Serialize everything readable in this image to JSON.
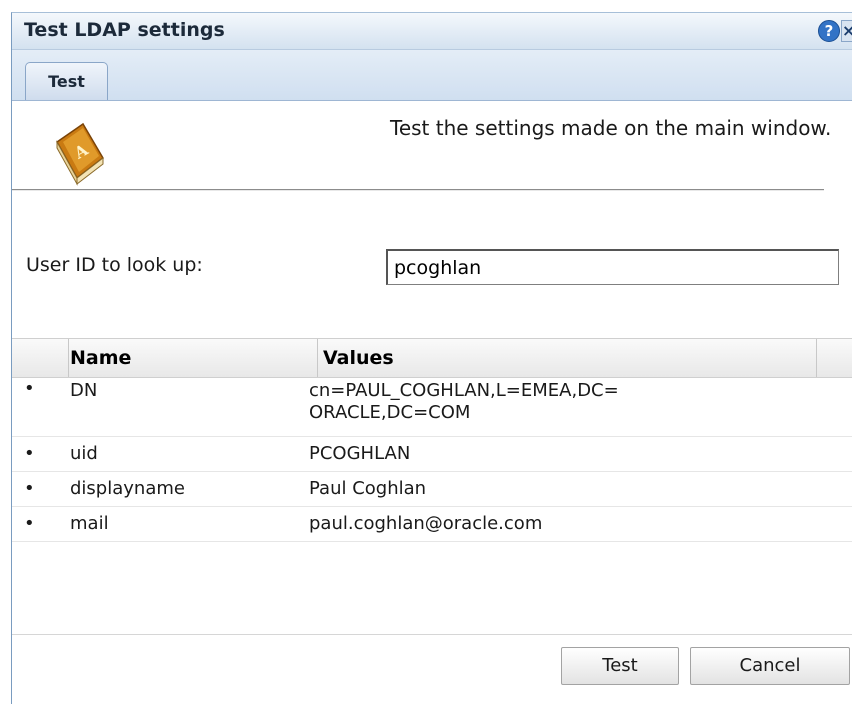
{
  "dialog": {
    "title": "Test LDAP settings",
    "help_label": "?",
    "close_label": "×"
  },
  "tabs": [
    {
      "label": "Test",
      "active": true
    }
  ],
  "header": {
    "icon": "address-book-icon",
    "description": "Test the settings made on the main window."
  },
  "lookup": {
    "label": "User ID to look up:",
    "value": "pcoghlan"
  },
  "results": {
    "columns": [
      "Name",
      "Values"
    ],
    "rows": [
      {
        "bullet": "•",
        "name": "DN",
        "value": "cn=PAUL_COGHLAN,L=EMEA,DC=\nORACLE,DC=COM"
      },
      {
        "bullet": "•",
        "name": "uid",
        "value": "PCOGHLAN"
      },
      {
        "bullet": "•",
        "name": "displayname",
        "value": "Paul Coghlan"
      },
      {
        "bullet": "•",
        "name": "mail",
        "value": "paul.coghlan@oracle.com"
      }
    ]
  },
  "buttons": {
    "test": "Test",
    "cancel": "Cancel"
  },
  "colors": {
    "titlebar": "#d4e2f0",
    "accent": "#3273c6"
  }
}
